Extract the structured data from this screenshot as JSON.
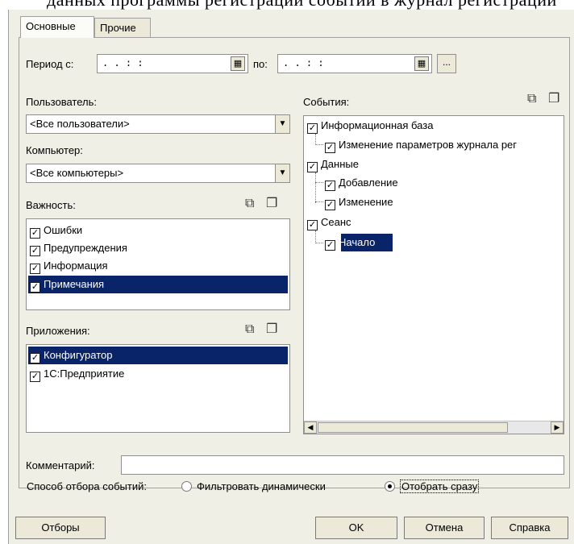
{
  "top_fragment": "данных программы регистрации событий в журнал регистрации",
  "tabs": [
    "Основные",
    "Прочие"
  ],
  "period": {
    "from_label": "Период с:",
    "from_value": ". .      : :",
    "to_label": "по:",
    "to_value": ". .      : :",
    "more_label": "..."
  },
  "user": {
    "label": "Пользователь:",
    "value": "<Все пользователи>"
  },
  "computer": {
    "label": "Компьютер:",
    "value": "<Все компьютеры>"
  },
  "importance": {
    "label": "Важность:",
    "items": [
      {
        "label": "Ошибки",
        "checked": true
      },
      {
        "label": "Предупреждения",
        "checked": true
      },
      {
        "label": "Информация",
        "checked": true
      },
      {
        "label": "Примечания",
        "checked": true
      }
    ]
  },
  "applications": {
    "label": "Приложения:",
    "items": [
      {
        "label": "Конфигуратор",
        "checked": true
      },
      {
        "label": "1С:Предприятие",
        "checked": true
      }
    ]
  },
  "events": {
    "label": "События:",
    "tree": [
      {
        "label": "Информационная база",
        "level": 0
      },
      {
        "label": "Изменение параметров журнала рег",
        "level": 1
      },
      {
        "label": "Данные",
        "level": 0
      },
      {
        "label": "Добавление",
        "level": 1
      },
      {
        "label": "Изменение",
        "level": 1
      },
      {
        "label": "Сеанс",
        "level": 0
      },
      {
        "label": "Начало",
        "level": 1
      }
    ]
  },
  "comment": {
    "label": "Комментарий:",
    "value": ""
  },
  "selection_method": {
    "label": "Способ отбора событий:",
    "options": [
      "Фильтровать динамически",
      "Отобрать сразу"
    ],
    "selected": "Отобрать сразу"
  },
  "buttons": {
    "filters": "Отборы",
    "ok": "OK",
    "cancel": "Отмена",
    "help": "Справка"
  },
  "icons": {
    "check_all": "check-all-icon",
    "uncheck_all": "uncheck-all-icon",
    "calendar": "calendar-icon",
    "dropdown": "chevron-down-icon"
  }
}
